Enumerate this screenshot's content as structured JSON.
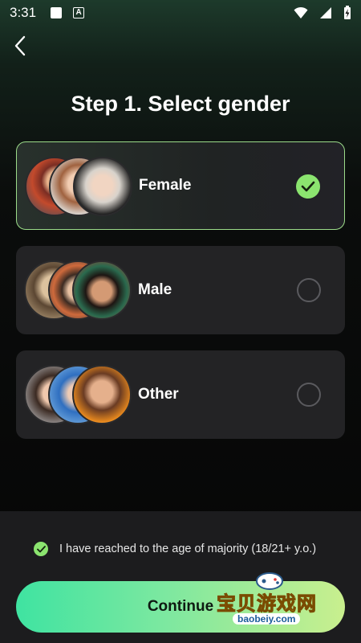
{
  "status_bar": {
    "time": "3:31",
    "icons": [
      "notification-square-icon",
      "a-notification-icon",
      "wifi-icon",
      "signal-icon",
      "battery-charging-icon"
    ]
  },
  "header": {
    "back_icon": "chevron-left-icon",
    "title": "Step 1. Select gender"
  },
  "options": [
    {
      "label": "Female",
      "selected": true
    },
    {
      "label": "Male",
      "selected": false
    },
    {
      "label": "Other",
      "selected": false
    }
  ],
  "footer": {
    "age_confirmation": "I have reached to the age of majority (18/21+ y.o.)",
    "age_confirmed": true,
    "continue_label": "Continue"
  },
  "watermark": {
    "text": "宝贝游戏网",
    "url": "baobeiy.com"
  },
  "colors": {
    "accent_green": "#8be46f",
    "button_gradient_start": "#3fe3a1",
    "button_gradient_end": "#c9ef8e",
    "card_bg": "#232325",
    "selected_border": "#9cdc8a"
  }
}
